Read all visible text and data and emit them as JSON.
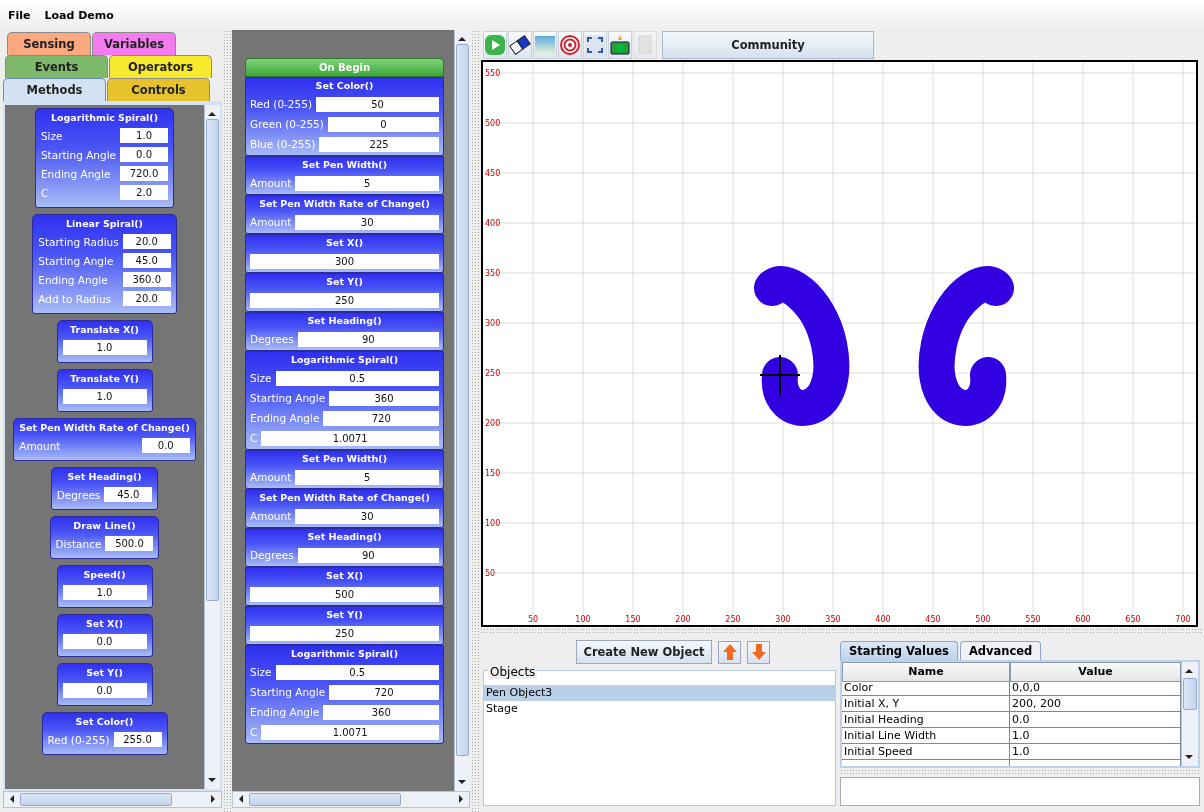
{
  "menu": [
    {
      "label": "File"
    },
    {
      "label": "Load Demo"
    }
  ],
  "category_tab_rows": [
    [
      {
        "label": "Sensing",
        "color": "#f9a880",
        "selected": false
      },
      {
        "label": "Variables",
        "color": "#f47cf0",
        "selected": false
      }
    ],
    [
      {
        "label": "Events",
        "color": "#7fba6c",
        "selected": false
      },
      {
        "label": "Operators",
        "color": "#f7ea2e",
        "selected": false
      }
    ],
    [
      {
        "label": "Methods",
        "color": "#d3e3f4",
        "selected": true
      },
      {
        "label": "Controls",
        "color": "#e6c22c",
        "selected": false
      }
    ]
  ],
  "palette": [
    {
      "title": "Logarithmic Spiral()",
      "params": [
        {
          "label": "Size",
          "value": "1.0"
        },
        {
          "label": "Starting Angle",
          "value": "0.0"
        },
        {
          "label": "Ending Angle",
          "value": "720.0"
        },
        {
          "label": "C",
          "value": "2.0"
        }
      ]
    },
    {
      "title": "Linear Spiral()",
      "params": [
        {
          "label": "Starting Radius",
          "value": "20.0"
        },
        {
          "label": "Starting Angle",
          "value": "45.0"
        },
        {
          "label": "Ending Angle",
          "value": "360.0"
        },
        {
          "label": "Add to Radius",
          "value": "20.0"
        }
      ]
    },
    {
      "title": "Translate X()",
      "params": [
        {
          "value": "1.0"
        }
      ]
    },
    {
      "title": "Translate Y()",
      "params": [
        {
          "value": "1.0"
        }
      ]
    },
    {
      "title": "Set Pen Width Rate of Change()",
      "params": [
        {
          "label": "Amount",
          "value": "0.0"
        }
      ]
    },
    {
      "title": "Set Heading()",
      "params": [
        {
          "label": "Degrees",
          "value": "45.0"
        }
      ]
    },
    {
      "title": "Draw Line()",
      "params": [
        {
          "label": "Distance",
          "value": "500.0"
        }
      ]
    },
    {
      "title": "Speed()",
      "params": [
        {
          "value": "1.0"
        }
      ]
    },
    {
      "title": "Set X()",
      "params": [
        {
          "value": "0.0"
        }
      ]
    },
    {
      "title": "Set Y()",
      "params": [
        {
          "value": "0.0"
        }
      ]
    },
    {
      "title": "Set Color()",
      "params": [
        {
          "label": "Red (0-255)",
          "value": "255.0"
        }
      ]
    }
  ],
  "script": {
    "header": "On Begin",
    "blocks": [
      {
        "title": "Set Color()",
        "params": [
          {
            "label": "Red (0-255)",
            "value": "50"
          },
          {
            "label": "Green (0-255)",
            "value": "0"
          },
          {
            "label": "Blue (0-255)",
            "value": "225"
          }
        ]
      },
      {
        "title": "Set Pen Width()",
        "params": [
          {
            "label": "Amount",
            "value": "5"
          }
        ]
      },
      {
        "title": "Set Pen Width Rate of Change()",
        "params": [
          {
            "label": "Amount",
            "value": "30"
          }
        ]
      },
      {
        "title": "Set X()",
        "params": [
          {
            "value": "300"
          }
        ]
      },
      {
        "title": "Set Y()",
        "params": [
          {
            "value": "250"
          }
        ]
      },
      {
        "title": "Set Heading()",
        "params": [
          {
            "label": "Degrees",
            "value": "90"
          }
        ]
      },
      {
        "title": "Logarithmic Spiral()",
        "params": [
          {
            "label": "Size",
            "value": "0.5"
          },
          {
            "label": "Starting Angle",
            "value": "360"
          },
          {
            "label": "Ending Angle",
            "value": "720"
          },
          {
            "label": "C",
            "value": "1.0071"
          }
        ]
      },
      {
        "title": "Set Pen Width()",
        "params": [
          {
            "label": "Amount",
            "value": "5"
          }
        ]
      },
      {
        "title": "Set Pen Width Rate of Change()",
        "params": [
          {
            "label": "Amount",
            "value": "30"
          }
        ]
      },
      {
        "title": "Set Heading()",
        "params": [
          {
            "label": "Degrees",
            "value": "90"
          }
        ]
      },
      {
        "title": "Set X()",
        "params": [
          {
            "value": "500"
          }
        ]
      },
      {
        "title": "Set Y()",
        "params": [
          {
            "value": "250"
          }
        ]
      },
      {
        "title": "Logarithmic Spiral()",
        "params": [
          {
            "label": "Size",
            "value": "0.5"
          },
          {
            "label": "Starting Angle",
            "value": "720"
          },
          {
            "label": "Ending Angle",
            "value": "360"
          },
          {
            "label": "C",
            "value": "1.0071"
          }
        ]
      }
    ]
  },
  "toolbar": [
    {
      "kind": "play",
      "disabled": false
    },
    {
      "kind": "eraser",
      "disabled": false
    },
    {
      "kind": "background",
      "disabled": false
    },
    {
      "kind": "target",
      "disabled": false
    },
    {
      "kind": "fullscreen",
      "disabled": false
    },
    {
      "kind": "camera",
      "disabled": false
    },
    {
      "kind": "document",
      "disabled": true
    }
  ],
  "community_button": "Community",
  "canvas": {
    "x_ticks": [
      "50",
      "100",
      "150",
      "200",
      "250",
      "300",
      "350",
      "400",
      "450",
      "500",
      "550",
      "600",
      "650",
      "700"
    ],
    "y_ticks": [
      "550",
      "500",
      "450",
      "400",
      "350",
      "300",
      "250",
      "200",
      "150",
      "100",
      "50"
    ]
  },
  "objects": {
    "create_button": "Create New Object",
    "group_label": "Objects",
    "items": [
      {
        "label": "Pen Object3",
        "selected": true
      },
      {
        "label": "Stage",
        "selected": false
      }
    ]
  },
  "properties": {
    "tabs": [
      {
        "label": "Starting Values",
        "selected": true
      },
      {
        "label": "Advanced",
        "selected": false
      }
    ],
    "columns": [
      "Name",
      "Value"
    ],
    "rows": [
      {
        "name": "Color",
        "value": "0,0,0"
      },
      {
        "name": "Initial X, Y",
        "value": "200, 200"
      },
      {
        "name": "Initial Heading",
        "value": "0.0"
      },
      {
        "name": "Initial Line Width",
        "value": "1.0"
      },
      {
        "name": "Initial Speed",
        "value": "1.0"
      }
    ]
  }
}
